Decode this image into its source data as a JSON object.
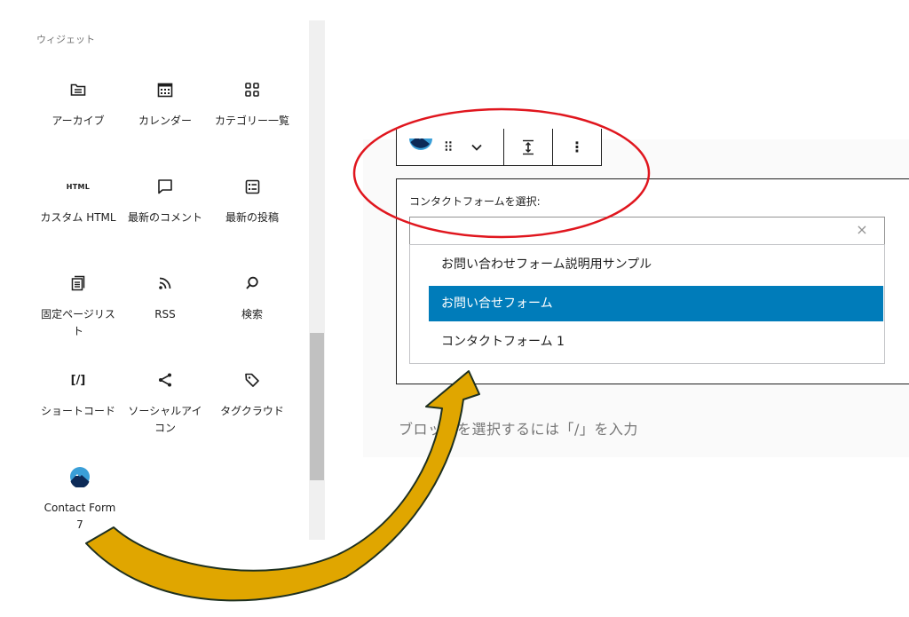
{
  "inserter": {
    "section_title": "ウィジェット",
    "blocks": [
      {
        "label": "アーカイブ"
      },
      {
        "label": "カレンダー"
      },
      {
        "label": "カテゴリー一覧"
      },
      {
        "label": "カスタム HTML",
        "icon_text": "HTML"
      },
      {
        "label": "最新のコメント"
      },
      {
        "label": "最新の投稿"
      },
      {
        "label": "固定ページリスト"
      },
      {
        "label": "RSS"
      },
      {
        "label": "検索"
      },
      {
        "label": "ショートコード",
        "icon_text": "[/]"
      },
      {
        "label": "ソーシャルアイコン"
      },
      {
        "label": "タグクラウド"
      },
      {
        "label": "Contact Form 7"
      }
    ]
  },
  "editor": {
    "block_label": "コンタクトフォームを選択:",
    "search_value": "",
    "clear_icon": "×",
    "options": [
      {
        "label": "お問い合わせフォーム説明用サンプル",
        "selected": false
      },
      {
        "label": "お問い合せフォーム",
        "selected": true
      },
      {
        "label": "コンタクトフォーム 1",
        "selected": false
      }
    ],
    "placeholder": "ブロックを選択するには「/」を入力"
  },
  "colors": {
    "accent": "#007cba",
    "annotation_red": "#e0161e",
    "arrow_fill": "#e0a600",
    "arrow_stroke": "#1e3020"
  }
}
